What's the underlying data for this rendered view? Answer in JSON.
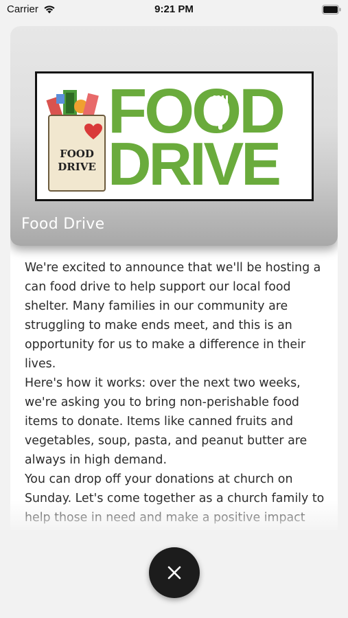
{
  "status_bar": {
    "carrier": "Carrier",
    "time": "9:21 PM",
    "wifi_icon": "wifi-icon",
    "battery_icon": "battery-icon"
  },
  "hero": {
    "logo": {
      "bag_text_line1": "FOOD",
      "bag_text_line2": "DRIVE",
      "word1": "FOOD",
      "word2": "DRIVE",
      "brand_color": "#6aab3c"
    },
    "title": "Food Drive"
  },
  "article": {
    "paragraphs": [
      "We're excited to announce that we'll be hosting a can food drive to help support our local food shelter. Many families in our community are struggling to make ends meet, and this is an opportunity for us to make a difference in their lives.",
      "Here's how it works: over the next two weeks, we're asking you to bring non-perishable food items to donate. Items like canned fruits and vegetables, soup, pasta, and peanut butter are always in high demand.",
      "You can drop off your donations at church on Sunday. Let's come together as a church family to help those in need and make a positive impact"
    ]
  },
  "close_button": {
    "icon": "close-icon",
    "color": "#1c1c1c"
  }
}
